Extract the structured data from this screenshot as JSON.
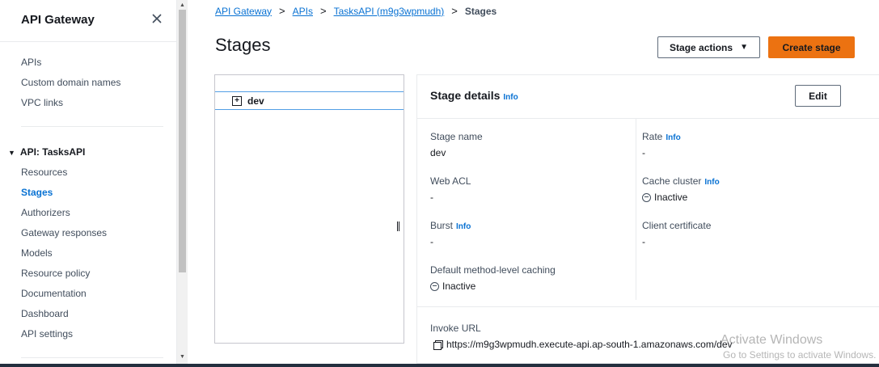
{
  "sidebar": {
    "title": "API Gateway",
    "top_items": [
      {
        "label": "APIs"
      },
      {
        "label": "Custom domain names"
      },
      {
        "label": "VPC links"
      }
    ],
    "section_label": "API: TasksAPI",
    "section_items": [
      {
        "label": "Resources"
      },
      {
        "label": "Stages"
      },
      {
        "label": "Authorizers"
      },
      {
        "label": "Gateway responses"
      },
      {
        "label": "Models"
      },
      {
        "label": "Resource policy"
      },
      {
        "label": "Documentation"
      },
      {
        "label": "Dashboard"
      },
      {
        "label": "API settings"
      }
    ],
    "active_item": "Stages"
  },
  "breadcrumb": {
    "items": [
      "API Gateway",
      "APIs",
      "TasksAPI (m9g3wpmudh)"
    ],
    "current": "Stages"
  },
  "page": {
    "title": "Stages",
    "stage_actions_label": "Stage actions",
    "create_stage_label": "Create stage"
  },
  "tree": {
    "stages": [
      "dev"
    ]
  },
  "details": {
    "title": "Stage details",
    "info_label": "Info",
    "edit_label": "Edit",
    "fields": {
      "stage_name": {
        "label": "Stage name",
        "value": "dev"
      },
      "web_acl": {
        "label": "Web ACL",
        "value": "-"
      },
      "burst": {
        "label": "Burst",
        "value": "-"
      },
      "default_caching": {
        "label": "Default method-level caching",
        "value": "Inactive"
      },
      "rate": {
        "label": "Rate",
        "value": "-"
      },
      "cache_cluster": {
        "label": "Cache cluster",
        "value": "Inactive"
      },
      "client_certificate": {
        "label": "Client certificate",
        "value": "-"
      }
    },
    "invoke_url": {
      "label": "Invoke URL",
      "value": "https://m9g3wpmudh.execute-api.ap-south-1.amazonaws.com/dev"
    }
  },
  "watermark": {
    "line1": "Activate Windows",
    "line2": "Go to Settings to activate Windows."
  },
  "colors": {
    "link": "#0972d3",
    "primary_button": "#ec7211",
    "bottom_bar": "#232f3e"
  }
}
